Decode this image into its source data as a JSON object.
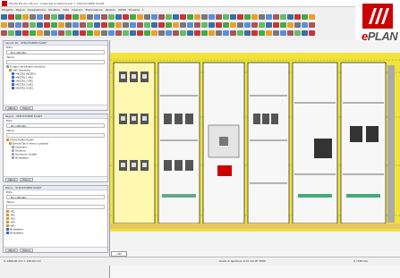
{
  "window": {
    "title": "EPLAN Electric P8 2.9 - [Cabinet] Schaltschrank = STRUCTURED PLANT"
  },
  "menu": [
    "Progetto",
    "Pagina",
    "Assegnazione",
    "Modifica",
    "Vista",
    "Inserisci",
    "Elaborazione",
    "Opzioni",
    "Utilità",
    "Finestra",
    "?"
  ],
  "logo": {
    "word_e": "e",
    "word_rest": "PLAN"
  },
  "panel1": {
    "header": "Layout 3D - STRUCTURED PLANT",
    "filter_label": "Filtro",
    "filter_value": "- Non attivato -",
    "value_label": "Valore",
    "tree": [
      "Gruppo identificativo struttura",
      "=NC (Impianto)",
      "=NCZR1 (NCZR1)",
      "=NCZR1.1 (NC)",
      "=NCZR1.2 (NC)",
      "=NCZR1.3 (NC)",
      "=NCZR1.4 (NC)"
    ],
    "foot": [
      "Albero",
      "Elenco"
    ]
  },
  "panel2": {
    "header": "Pagine - STRUCTURED PLANT",
    "filter_label": "Filtro",
    "filter_value": "- Non attivato -",
    "value_label": "Valore",
    "tree": [
      "STRUCTURED PLANT",
      "Elenchi/Tipi di elenco: (project)",
      "Copertina",
      "Struttura",
      "Sommario contatti",
      "Morsettiera"
    ],
    "foot": [
      "Albero",
      "Elenco"
    ]
  },
  "panel3": {
    "header": "Macro - STRUCTURED PLANT",
    "filter_label": "Filtro",
    "filter_value": "- Non attivato -",
    "value_label": "Valore",
    "tree": [
      "+B1",
      "+B2",
      "+B3",
      "+B4",
      "+B5",
      "Morsettiera",
      "Morsettiera"
    ],
    "foot": [
      "Albero",
      "Elenco"
    ]
  },
  "status": {
    "left": "X: 2466,00 mm  Y: 236,00 mm",
    "middle": "Grado di apertura: 0.13 mm  RT 3000",
    "right": "0 / 528 mm"
  },
  "page_tab": "+NC",
  "colors": {
    "cabinet_yellow": "#f3e23a",
    "grid_green": "#22aa33",
    "accent_red": "#cc0000"
  }
}
